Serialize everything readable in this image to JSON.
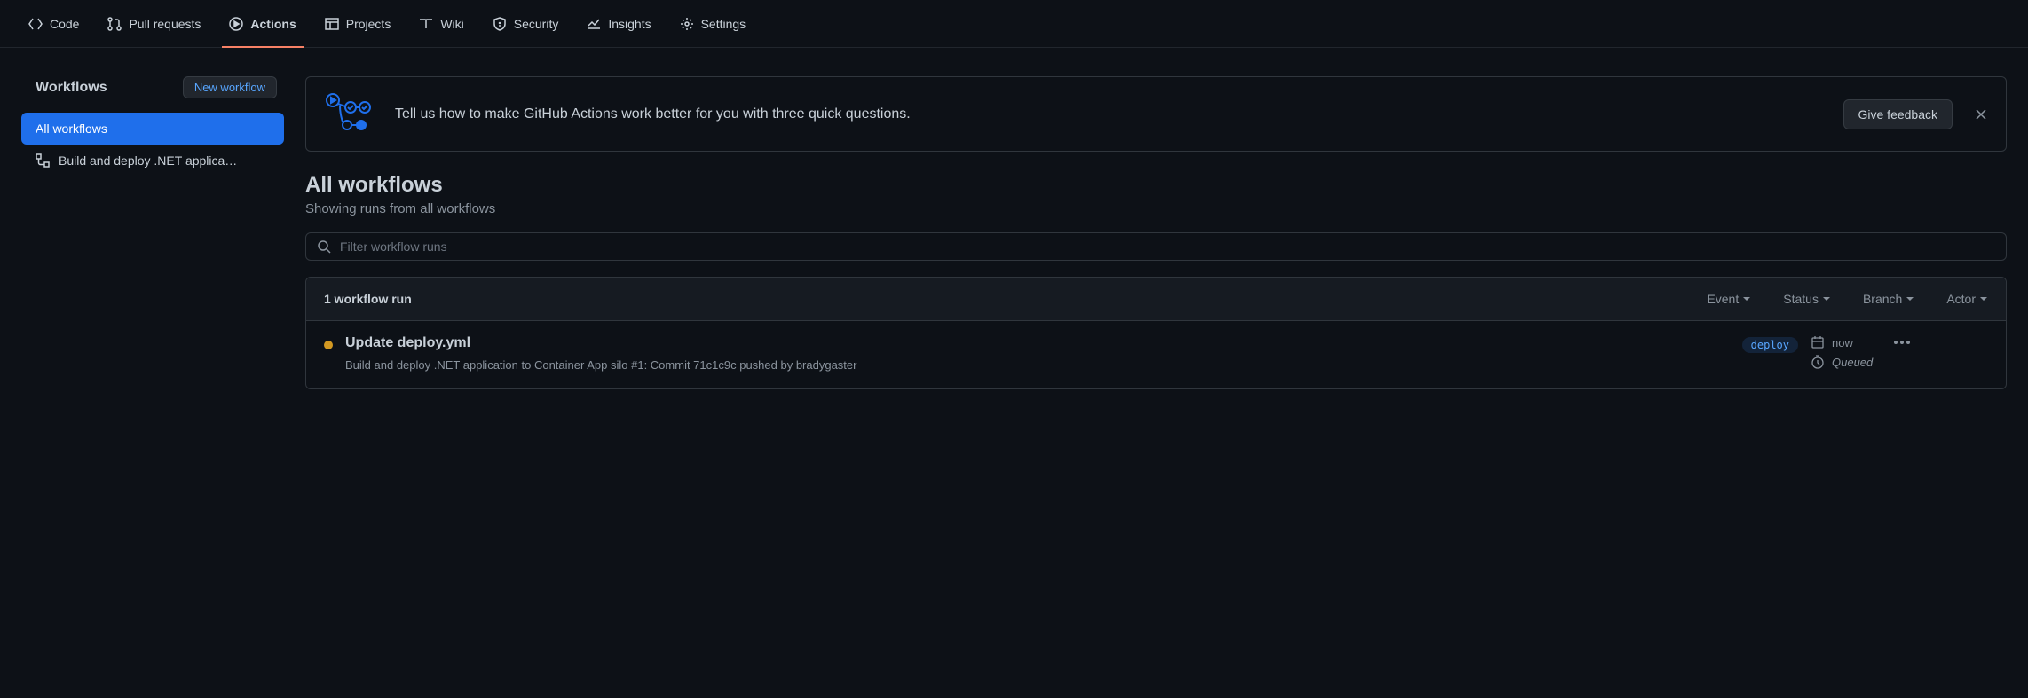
{
  "nav": {
    "items": [
      {
        "label": "Code",
        "icon": "code-icon"
      },
      {
        "label": "Pull requests",
        "icon": "git-pull-request-icon"
      },
      {
        "label": "Actions",
        "icon": "play-icon",
        "active": true
      },
      {
        "label": "Projects",
        "icon": "table-icon"
      },
      {
        "label": "Wiki",
        "icon": "book-icon"
      },
      {
        "label": "Security",
        "icon": "shield-icon"
      },
      {
        "label": "Insights",
        "icon": "graph-icon"
      },
      {
        "label": "Settings",
        "icon": "gear-icon"
      }
    ]
  },
  "sidebar": {
    "title": "Workflows",
    "new_button": "New workflow",
    "items": [
      {
        "label": "All workflows",
        "selected": true
      },
      {
        "label": "Build and deploy .NET applica…",
        "selected": false,
        "icon": "workflow-icon"
      }
    ]
  },
  "banner": {
    "text": "Tell us how to make GitHub Actions work better for you with three quick questions.",
    "button": "Give feedback"
  },
  "page": {
    "title": "All workflows",
    "subtitle": "Showing runs from all workflows",
    "filter_placeholder": "Filter workflow runs"
  },
  "runs": {
    "count_label": "1 workflow run",
    "filters": [
      "Event",
      "Status",
      "Branch",
      "Actor"
    ],
    "items": [
      {
        "status": "queued",
        "title": "Update deploy.yml",
        "workflow_name": "Build and deploy .NET application to Container App silo",
        "run_number": "#1",
        "commit_desc": "Commit 71c1c9c pushed by bradygaster",
        "branch": "deploy",
        "time": "now",
        "state": "Queued"
      }
    ]
  }
}
